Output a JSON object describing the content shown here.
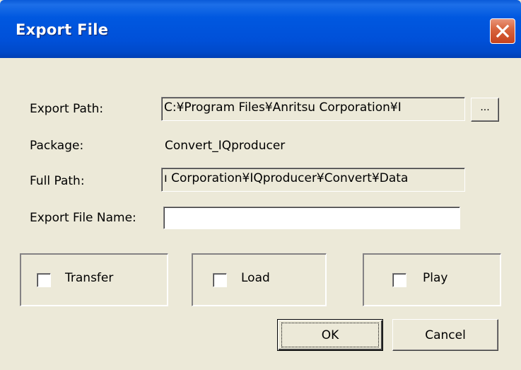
{
  "window": {
    "title": "Export File"
  },
  "form": {
    "export_path_label": "Export Path:",
    "export_path_value": "C:¥Program Files¥Anritsu Corporation¥I",
    "browse_label": "...",
    "package_label": "Package:",
    "package_value": "Convert_IQproducer",
    "full_path_label": "Full Path:",
    "full_path_value": "ı Corporation¥IQproducer¥Convert¥Data",
    "export_file_name_label": "Export File Name:",
    "export_file_name_value": ""
  },
  "options": {
    "transfer_label": "Transfer",
    "transfer_checked": false,
    "load_label": "Load",
    "load_checked": false,
    "play_label": "Play",
    "play_checked": false
  },
  "buttons": {
    "ok_label": "OK",
    "cancel_label": "Cancel"
  },
  "colors": {
    "titlebar": "#0054e3",
    "dialog_bg": "#ece9d8",
    "close_button": "#d9663f"
  },
  "icons": {
    "close": "close-icon"
  }
}
